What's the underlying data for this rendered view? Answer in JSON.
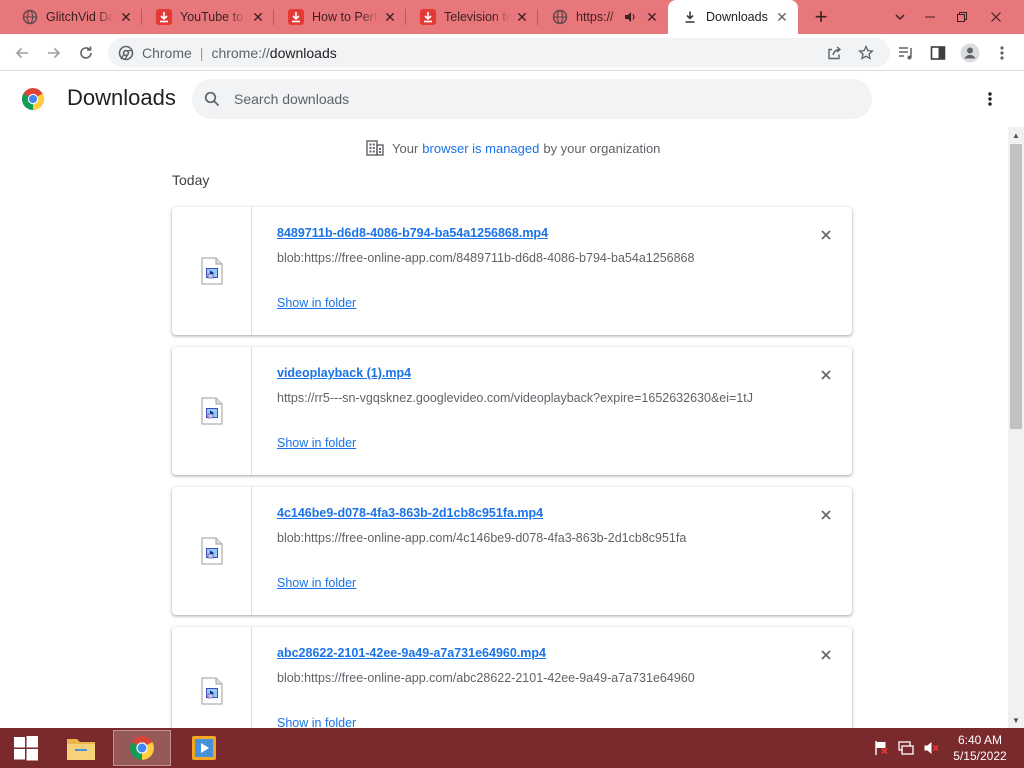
{
  "tabs": [
    {
      "title": "GlitchVid Da",
      "icon": "globe-icon",
      "active": false
    },
    {
      "title": "YouTube to",
      "icon": "download-red-icon",
      "active": false
    },
    {
      "title": "How to Perfo",
      "icon": "download-red-icon",
      "active": false
    },
    {
      "title": "Television te",
      "icon": "download-red-icon",
      "active": false
    },
    {
      "title": "https://",
      "icon": "globe-icon",
      "active": false,
      "audio": true
    },
    {
      "title": "Downloads",
      "icon": "download-icon",
      "active": true
    }
  ],
  "toolbar": {
    "site_label": "Chrome",
    "url_scheme": "chrome://",
    "url_host": "downloads"
  },
  "header": {
    "title": "Downloads",
    "search_placeholder": "Search downloads"
  },
  "managed_notice": {
    "prefix": "Your",
    "link": "browser is managed",
    "suffix": "by your organization"
  },
  "date_group": "Today",
  "downloads": [
    {
      "filename": "8489711b-d6d8-4086-b794-ba54a1256868.mp4",
      "source": "blob:https://free-online-app.com/8489711b-d6d8-4086-b794-ba54a1256868",
      "action": "Show in folder"
    },
    {
      "filename": "videoplayback (1).mp4",
      "source": "https://rr5---sn-vgqsknez.googlevideo.com/videoplayback?expire=1652632630&ei=1tJ",
      "action": "Show in folder"
    },
    {
      "filename": "4c146be9-d078-4fa3-863b-2d1cb8c951fa.mp4",
      "source": "blob:https://free-online-app.com/4c146be9-d078-4fa3-863b-2d1cb8c951fa",
      "action": "Show in folder"
    },
    {
      "filename": "abc28622-2101-42ee-9a49-a7a731e64960.mp4",
      "source": "blob:https://free-online-app.com/abc28622-2101-42ee-9a49-a7a731e64960",
      "action": "Show in folder"
    }
  ],
  "taskbar": {
    "time": "6:40 AM",
    "date": "5/15/2022"
  },
  "colors": {
    "tabstrip": "#e8777c",
    "taskbar": "#7a2a2c",
    "link": "#1a73e8"
  }
}
